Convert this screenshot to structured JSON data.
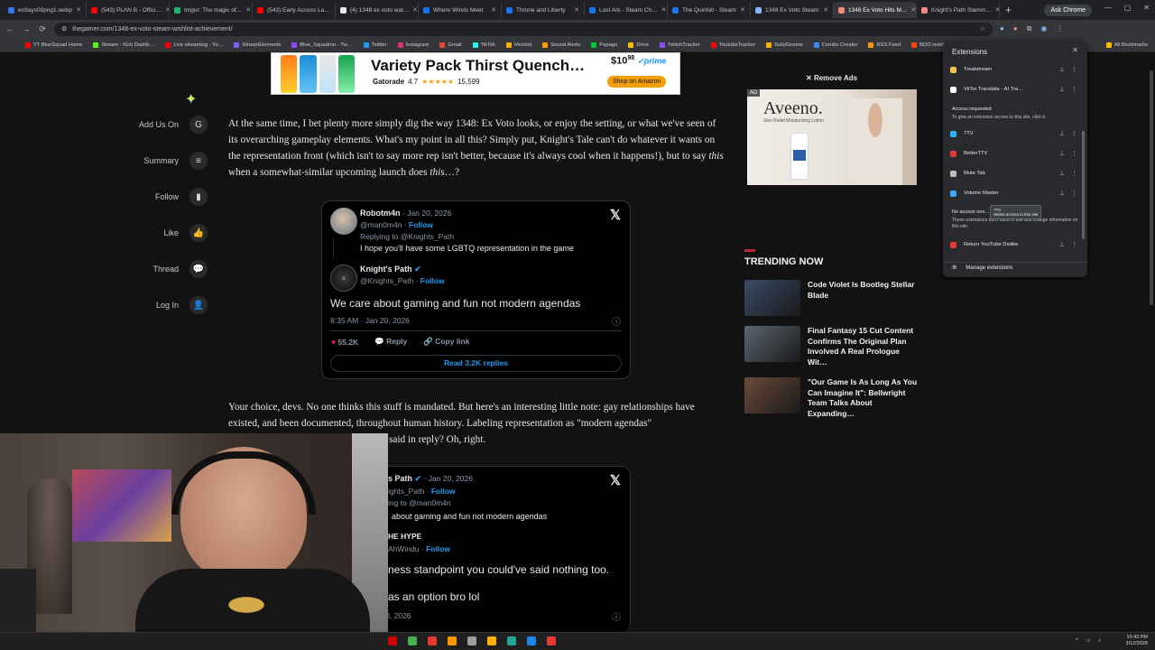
{
  "browser": {
    "tabs": [
      {
        "label": "en9ays09png1.webp",
        "color": "#3b78e7"
      },
      {
        "label": "(543) PLAN B - Offici…",
        "color": "#ff0000"
      },
      {
        "label": "Imgur: The magic of…",
        "color": "#1bb76e"
      },
      {
        "label": "(543) Early Access La…",
        "color": "#ff0000"
      },
      {
        "label": "(4) 1348 ex voto wal…",
        "color": "#e7e9ea"
      },
      {
        "label": "Where Winds Meet",
        "color": "#1a73e8"
      },
      {
        "label": "Throne and Liberty",
        "color": "#1a73e8"
      },
      {
        "label": "Lost Ark - Steam Ch…",
        "color": "#1a73e8"
      },
      {
        "label": "The Quinfall - Steam",
        "color": "#1a73e8"
      },
      {
        "label": "1348 Ex Voto Steam",
        "color": "#8ab4f8"
      },
      {
        "label": "1348 Ex Voto Hits M…",
        "color": "#f28b82"
      },
      {
        "label": "Knight's Path Slamm…",
        "color": "#f28b82"
      }
    ],
    "ask_chrome": "Ask Chrome",
    "url": "thegamer.com/1348-ex-voto-steam-wishlist-achievement/",
    "bookmarks": [
      {
        "label": "YT BlueSquad Home",
        "color": "#ff0000"
      },
      {
        "label": "Stream - Kick Dashb…",
        "color": "#53fc18"
      },
      {
        "label": "Live streaming - Yo…",
        "color": "#ff0000"
      },
      {
        "label": "StreamElements",
        "color": "#7b61ff"
      },
      {
        "label": "Blue_Squadron - Tw…",
        "color": "#9146ff"
      },
      {
        "label": "Twitter",
        "color": "#1d9bf0"
      },
      {
        "label": "Instagram",
        "color": "#e1306c"
      },
      {
        "label": "Gmail",
        "color": "#ea4335"
      },
      {
        "label": "TikTok",
        "color": "#25f4ee"
      },
      {
        "label": "Moobot",
        "color": "#f4b400"
      },
      {
        "label": "Sound Alerts",
        "color": "#ff9800"
      },
      {
        "label": "Papago",
        "color": "#00c73c"
      },
      {
        "label": "Drive",
        "color": "#fbbc04"
      },
      {
        "label": "TwitchTracker",
        "color": "#9146ff"
      },
      {
        "label": "YoutubeTracker",
        "color": "#ff0000"
      },
      {
        "label": "SullyGnome",
        "color": "#f4b400"
      },
      {
        "label": "Combo Creator",
        "color": "#4285f4"
      },
      {
        "label": "RSS Feed",
        "color": "#ff9800"
      },
      {
        "label": "BDO reddit",
        "color": "#ff4500"
      }
    ],
    "all_bookmarks": "All Bookmarks"
  },
  "ad_top": {
    "title": "Variety Pack Thirst Quench…",
    "brand": "Gatorade",
    "rating": "4.7",
    "stars": "★★★★★",
    "reviews": "15,599",
    "price": "$10",
    "price_cents": "98",
    "prime": "✓prime",
    "cta": "Shop on Amazon"
  },
  "sidebar": {
    "items": [
      {
        "label": "Add Us On",
        "icon": "G"
      },
      {
        "label": "Summary",
        "icon": "≡"
      },
      {
        "label": "Follow",
        "icon": "▮"
      },
      {
        "label": "Like",
        "icon": "👍"
      },
      {
        "label": "Thread",
        "icon": "💬"
      },
      {
        "label": "Log In",
        "icon": "👤"
      }
    ]
  },
  "article": {
    "para1_a": "At the same time, I bet plenty more simply dig the way 1348: Ex Voto looks, or enjoy the setting, or what we've seen of its overarching gameplay elements. What's my point in all this? Simply put, Knight's Tale can't do whatever it wants on the representation front (which isn't to say more rep isn't better, because it's always cool when it happens!), but to say ",
    "para1_em1": "this",
    "para1_b": " when a somewhat-similar upcoming launch does ",
    "para1_em2": "this",
    "para1_c": "…?",
    "para2": "Your choice, devs. No one thinks this stuff is mandated. But here's an interesting little note: gay relationships have existed, and been documented, throughout human history. Labeling representation as \"modern agendas\"",
    "para2_cont": "said in reply? Oh, right."
  },
  "tweet1": {
    "reply_name": "Robotm4n",
    "reply_handle": "@man0m4n",
    "reply_date": "· Jan 20, 2026",
    "follow": "Follow",
    "replying_to": "Replying to @Knights_Path",
    "reply_text": "I hope you'll have some LGBTQ representation in the game",
    "name": "Knight's Path",
    "handle": "@Knights_Path",
    "text": "We care about gaming and fun not modern agendas",
    "time": "8:35 AM · Jan 20, 2026",
    "likes": "55.2K",
    "reply_btn": "Reply",
    "copy_link": "Copy link",
    "read_replies": "Read 3.2K replies"
  },
  "tweet2": {
    "name_partial": "s Path",
    "date": "· Jan 20, 2026",
    "handle_partial": "ights_Path",
    "follow": "Follow",
    "replying_to": "ing to @man0m4n",
    "quoted_text": "about gaming and fun not modern agendas",
    "name2_partial": "HE HYPE",
    "handle2_partial": "AhWindu",
    "text_line1": "ness standpoint you could've said nothing too.",
    "text_line2": "as an option bro lol",
    "time_partial": "l, 2026"
  },
  "right": {
    "remove_ads": "Remove Ads",
    "ad_label": "AD",
    "ad_brand": "Aveeno.",
    "ad_sub": "Skin Relief Moisturizing Lotion",
    "trending_title": "TRENDING NOW",
    "trending": [
      {
        "title": "Code Violet Is Bootleg Stellar Blade",
        "color": "#3a4a66"
      },
      {
        "title": "Final Fantasy 15 Cut Content Confirms The Original Plan Involved A Real Prologue Wit…",
        "color": "#5b6470"
      },
      {
        "title": "\"Our Game Is As Long As You Can Imagine It\": Bellwright Team Talks About Expanding…",
        "color": "#6b4a3a"
      }
    ]
  },
  "extensions": {
    "title": "Extensions",
    "items_top": [
      {
        "label": "Treatstream",
        "color": "#f6c343"
      },
      {
        "label": "ViiTor Translate - AI Tra…",
        "color": "#ffffff"
      }
    ],
    "access_requested": "Access requested",
    "access_sub": "To give an extension access to this site, click it.",
    "items_mid": [
      {
        "label": "7TV",
        "color": "#29b6f6"
      },
      {
        "label": "BetterTTV",
        "color": "#e53935"
      },
      {
        "label": "Mute Tab",
        "color": "#bdbdbd"
      },
      {
        "label": "Volume Master",
        "color": "#42a5f5"
      }
    ],
    "tooltip_title": "7TV",
    "tooltip_text": "Wants access to this site",
    "no_access": "No access nee…",
    "no_access_sub": "These extensions don't need to see and change information on this site.",
    "items_bottom": [
      {
        "label": "Return YouTube Dislike",
        "color": "#e53935"
      }
    ],
    "manage": "Manage extensions"
  },
  "taskbar": {
    "time": "10:43 PM",
    "date": "3/12/2026"
  }
}
